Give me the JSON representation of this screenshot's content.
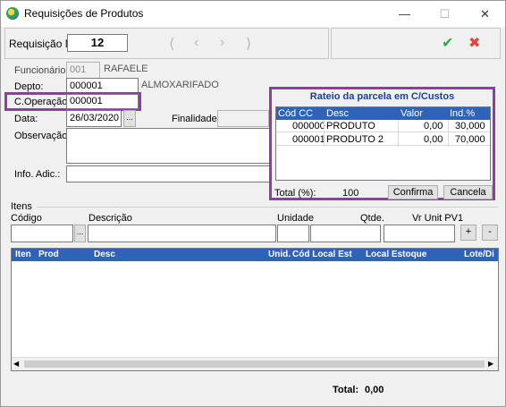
{
  "window": {
    "title": "Requisições de Produtos",
    "controls": {
      "minimize": "—",
      "maximize": "☐",
      "close": "✕"
    }
  },
  "header": {
    "requisicao_label": "Requisição No.",
    "requisicao_value": "12",
    "confirm_glyph": "✔",
    "cancel_glyph": "✖"
  },
  "nav": {
    "first": "⟨",
    "prev": "‹",
    "next": "›",
    "last": "⟩"
  },
  "form": {
    "funcionario_label": "Funcionário:",
    "funcionario_code": "001",
    "funcionario_name": "RAFAELE",
    "depto_label": "Depto:",
    "depto_code": "000001",
    "depto_name": "ALMOXARIFADO",
    "operacao_label": "C.Operação:",
    "operacao_code": "000001",
    "data_label": "Data:",
    "data_value": "26/03/2020",
    "data_btn": "...",
    "finalidade_label": "Finalidade:",
    "observacao_label": "Observação:",
    "info_label": "Info. Adic.:"
  },
  "popup": {
    "title": "Rateio da parcela em  C/Custos",
    "columns": [
      "Cód CC",
      "Desc",
      "Valor",
      "Ind.%"
    ],
    "rows": [
      {
        "cod": "000000",
        "desc": "PRODUTO",
        "valor": "0,00",
        "ind": "30,000"
      },
      {
        "cod": "000001",
        "desc": "PRODUTO 2",
        "valor": "0,00",
        "ind": "70,000"
      }
    ],
    "total_label": "Total (%):",
    "total_value": "100",
    "confirma": "Confirma",
    "cancela": "Cancela"
  },
  "itens": {
    "section_label": "Itens",
    "codigo_label": "Código",
    "descricao_label": "Descrição",
    "unidade_label": "Unidade",
    "qtde_label": "Qtde.",
    "vrunit_label": "Vr Unit PV1",
    "lookup_btn": "...",
    "add_btn": "+",
    "remove_btn": "-"
  },
  "grid": {
    "columns": [
      "Iten",
      "Prod",
      "Desc",
      "Unid.",
      "Cód Local Est",
      "Local Estoque",
      "Lote/Di"
    ]
  },
  "footer": {
    "total_label": "Total:",
    "total_value": "0,00"
  },
  "colors": {
    "accent_purple": "#8b3fa0",
    "grid_header": "#2f63b7",
    "title_blue": "#1a3fa0"
  }
}
